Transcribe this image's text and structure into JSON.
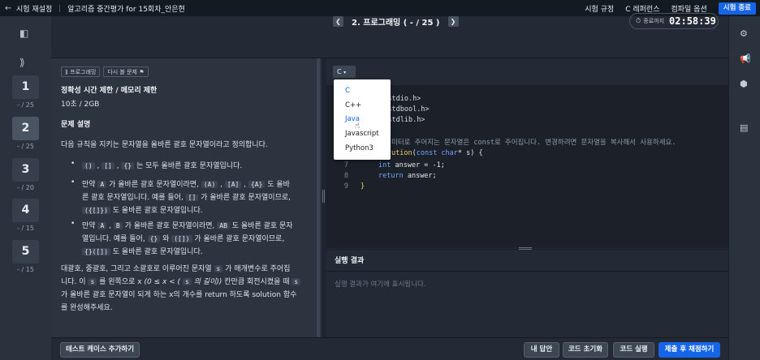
{
  "topbar": {
    "back_icon": "arrow-left-icon",
    "crumb1": "시험 재설정",
    "crumb2": "알고리즘 중간평가 for 15회차_안은현",
    "links": [
      "시험 규정",
      "C 레퍼런스",
      "컴파일 옵션"
    ],
    "exit_label": "시험 종료"
  },
  "rail": {
    "questions": [
      {
        "num": "1",
        "sub": "- / 25",
        "active": false
      },
      {
        "num": "2",
        "sub": "- / 25",
        "active": true
      },
      {
        "num": "3",
        "sub": "- / 20",
        "active": false
      },
      {
        "num": "4",
        "sub": "- / 15",
        "active": false
      },
      {
        "num": "5",
        "sub": "- / 15",
        "active": false
      }
    ]
  },
  "header": {
    "question_title": "2. 프로그래밍 ( - / 25 )",
    "timer_label": "종료까지",
    "timer_value": "02:58:39"
  },
  "problem": {
    "tags": [
      "프로그래밍",
      "다시 볼 문제"
    ],
    "limit_heading": "정확성 시간 제한 / 메모리 제한",
    "limit_value": "10초 / 2GB",
    "desc_heading": "문제 설명",
    "intro": "다음 규칙을 지키는 문자열을 올바른 괄호 문자열이라고 정의합니다.",
    "b1_c1": "()",
    "b1_c2": "[]",
    "b1_c3": "{}",
    "b1_text": "는 모두 올바른 괄호 문자열입니다.",
    "b2_pre": "만약",
    "b2_c1": "A",
    "b2_mid": "가 올바른 괄호 문자열이라면,",
    "b2_c2": "(A)",
    "b2_c3": "[A]",
    "b2_c4": "{A}",
    "b2_end": "도 올바",
    "b2_line2_pre": "른 괄호 문자열입니다. 예를 들어,",
    "b2_c5": "[]",
    "b2_line2_end": "가 올바른 괄호 문자열이므로,",
    "b2_c6": "({[]})",
    "b2_line3": "도 올바른 괄호 문자열입니다.",
    "b3_pre": "만약",
    "b3_c1": "A",
    "b3_c2": "B",
    "b3_mid": "가 올바른 괄호 문자열이라면,",
    "b3_c3": "AB",
    "b3_end": "도 올바른 괄호 문자",
    "b3_line2_pre": "열입니다. 예를 들어,",
    "b3_c4": "{}",
    "b3_line2_mid": "와",
    "b3_c5": "([])",
    "b3_line2_end": "가 올바른 괄호 문자열이므로,",
    "b3_c6": "{}([])",
    "b3_line3": "도 올바른 괄호 문자열입니다.",
    "p1_a": "대괄호, 중괄호, 그리고 소괄호로 이루어진 문자열",
    "p1_c1": "s",
    "p1_b": "가 매개변수로 주어집",
    "p2_a": "니다. 이",
    "p2_c1": "s",
    "p2_b": "를 왼쪽으로 x",
    "p2_ital_a": "(0 ≤ x < (",
    "p2_c2": "s",
    "p2_ital_b": "의 길이))",
    "p2_c": "칸만큼 회전시켰을 때",
    "p2_c3": "s",
    "p3": "가 올바른 괄호 문자열이 되게 하는 x의 개수를 return 하도록 solution 함수",
    "p4": "를 완성해주세요."
  },
  "editor": {
    "language": "C",
    "dropdown": [
      "C",
      "C++",
      "Java",
      "Javascript",
      "Python3"
    ],
    "lines": [
      {
        "n": "",
        "t": "e <stdio.h>"
      },
      {
        "n": "",
        "t": "e <stdbool.h>"
      },
      {
        "n": "",
        "t": "e <stdlib.h>"
      },
      {
        "n": "",
        "t": ""
      },
      {
        "n": "",
        "t": "미터로 주어지는 문자열은 const로 주어집니다. 변경하려면 문자열을 복사해서 사용하세요."
      },
      {
        "n": "",
        "t": "ution(const char* s) {"
      },
      {
        "n": "7",
        "t": "int answer = -1;"
      },
      {
        "n": "8",
        "t": "return answer;"
      },
      {
        "n": "9",
        "t": "}"
      }
    ]
  },
  "result": {
    "heading": "실행 결과",
    "placeholder": "실행 결과가 여기에 표시됩니다."
  },
  "bottombar": {
    "add_testcase": "테스트 케이스 추가하기",
    "my_answer": "내 답안",
    "reset_code": "코드 초기화",
    "run_code": "코드 실행",
    "submit": "제출 후 채점하기"
  }
}
